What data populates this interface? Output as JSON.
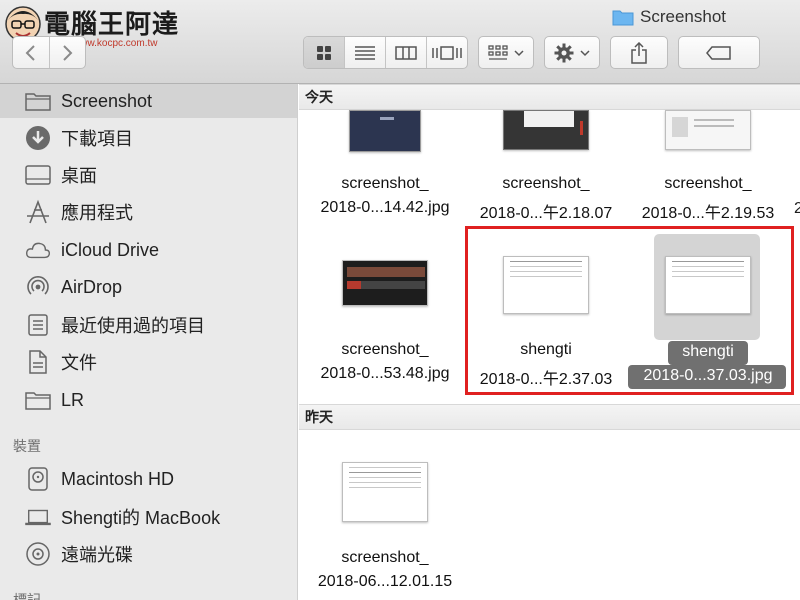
{
  "logo": {
    "brand": "電腦王阿達",
    "url": "http://www.kocpc.com.tw"
  },
  "window": {
    "title": "Screenshot",
    "folder_icon": "folder-icon"
  },
  "toolbar": {
    "back_icon": "chevron-left-icon",
    "forward_icon": "chevron-right-icon",
    "views": [
      "icon-view",
      "list-view",
      "column-view",
      "cover-flow-view"
    ],
    "active_view": "icon-view",
    "arrange_icon": "arrange-grid-icon",
    "action_icon": "gear-icon",
    "share_icon": "share-icon",
    "tag_icon": "tag-icon"
  },
  "sidebar": {
    "items": [
      {
        "label": "Screenshot",
        "icon": "folder-icon",
        "selected": true
      },
      {
        "label": "下載項目",
        "icon": "download-icon"
      },
      {
        "label": "桌面",
        "icon": "desktop-icon"
      },
      {
        "label": "應用程式",
        "icon": "applications-icon"
      },
      {
        "label": "iCloud Drive",
        "icon": "cloud-icon"
      },
      {
        "label": "AirDrop",
        "icon": "airdrop-icon"
      },
      {
        "label": "最近使用過的項目",
        "icon": "recents-icon"
      },
      {
        "label": "文件",
        "icon": "documents-icon"
      },
      {
        "label": "LR",
        "icon": "folder-icon"
      }
    ],
    "devices_header": "裝置",
    "devices": [
      {
        "label": "Macintosh HD",
        "icon": "hard-drive-icon"
      },
      {
        "label": "Shengti的 MacBook",
        "icon": "laptop-icon"
      },
      {
        "label": "遠端光碟",
        "icon": "disc-icon"
      }
    ],
    "tags_header": "標記"
  },
  "content": {
    "today_header": "今天",
    "yesterday_header": "昨天",
    "today_row1": [
      {
        "line1": "screenshot_",
        "line2": "2018-0...14.42.jpg"
      },
      {
        "line1": "screenshot_",
        "line2": "2018-0...午2.18.07"
      },
      {
        "line1": "screenshot_",
        "line2": "2018-0...午2.19.53"
      }
    ],
    "today_row2": [
      {
        "line1": "screenshot_",
        "line2": "2018-0...53.48.jpg"
      },
      {
        "line1": "shengti",
        "line2": "2018-0...午2.37.03"
      },
      {
        "line1": "shengti",
        "line2": "2018-0...37.03.jpg",
        "selected": true
      }
    ],
    "overflow_label": "2",
    "yesterday_row": [
      {
        "line1": "screenshot_",
        "line2": "2018-06...12.01.15"
      }
    ]
  },
  "colors": {
    "highlight": "#e02020",
    "selection": "#707070",
    "sidebar_bg": "#eaeaea"
  }
}
